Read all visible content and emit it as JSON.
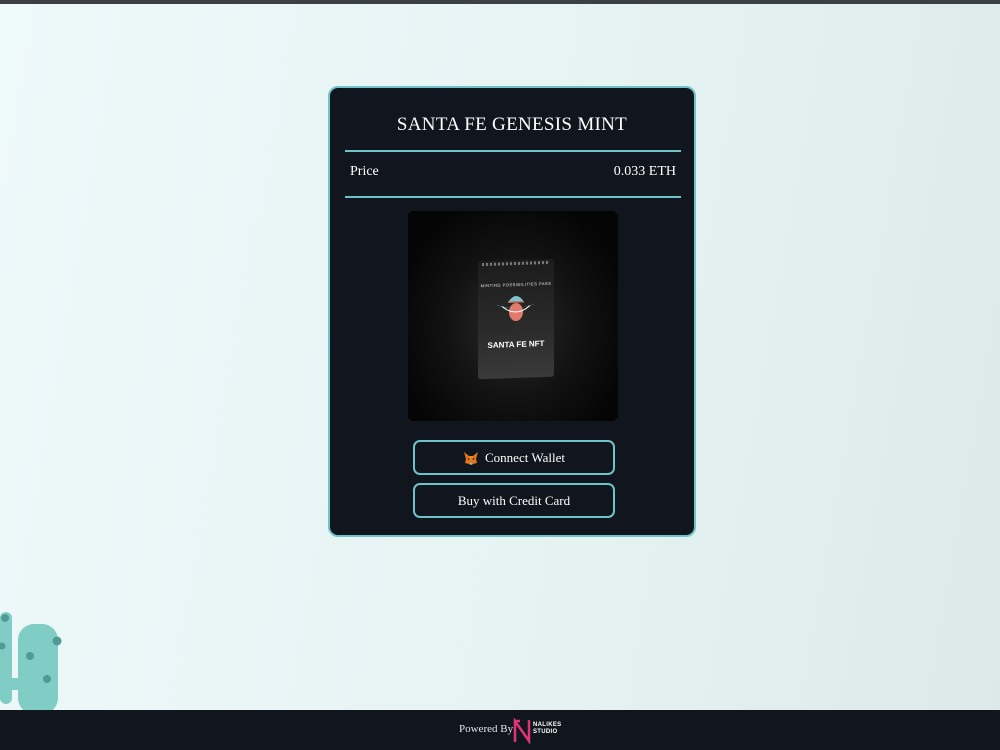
{
  "mint": {
    "title": "SANTA FE GENESIS MINT",
    "price_label": "Price",
    "price_value": "0.033 ETH"
  },
  "nft": {
    "arc_text": "MINTING POSSIBILITIES PASS",
    "name": "SANTA FE NFT"
  },
  "buttons": {
    "connect_wallet": "Connect Wallet",
    "connect_wallet_icon": "metamask-fox-icon",
    "credit_card": "Buy with Credit Card"
  },
  "footer": {
    "powered_by": "Powered By",
    "studio_line1": "NALIKES",
    "studio_line2": "STUDIO"
  },
  "colors": {
    "accent": "#6fc3c8",
    "card_bg": "#11151d",
    "footer_bg": "#11151d",
    "cactus": "#7fcdc4"
  }
}
